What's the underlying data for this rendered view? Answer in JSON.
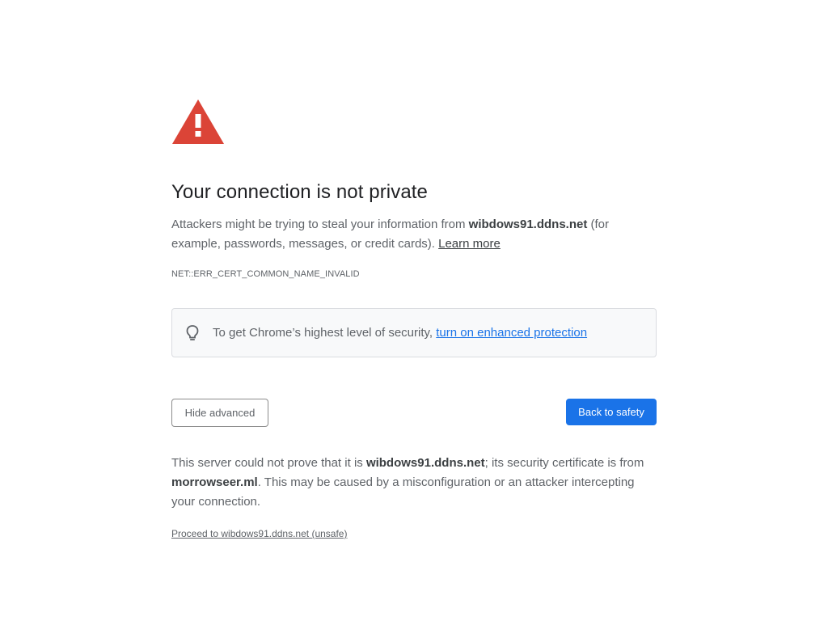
{
  "heading": "Your connection is not private",
  "explanation": {
    "prefix": "Attackers might be trying to steal your information from ",
    "host": "wibdows91.ddns.net",
    "suffix": " (for example, passwords, messages, or credit cards). ",
    "learn_more": "Learn more"
  },
  "error_code": "NET::ERR_CERT_COMMON_NAME_INVALID",
  "enhanced_protection": {
    "text": "To get Chrome’s highest level of security, ",
    "link": "turn on enhanced protection"
  },
  "buttons": {
    "hide_advanced": "Hide advanced",
    "back_to_safety": "Back to safety"
  },
  "details": {
    "part1": "This server could not prove that it is ",
    "host": "wibdows91.ddns.net",
    "part2": "; its security certificate is from ",
    "issuer": "morrowseer.ml",
    "part3": ". This may be caused by a misconfiguration or an attacker intercepting your connection."
  },
  "proceed_link": "Proceed to wibdows91.ddns.net (unsafe)",
  "colors": {
    "warning_red": "#db4437",
    "primary_blue": "#1a73e8",
    "text_gray": "#5f6368",
    "heading_dark": "#202124"
  },
  "icons": {
    "warning": "warning-triangle-icon",
    "bulb": "lightbulb-icon"
  }
}
